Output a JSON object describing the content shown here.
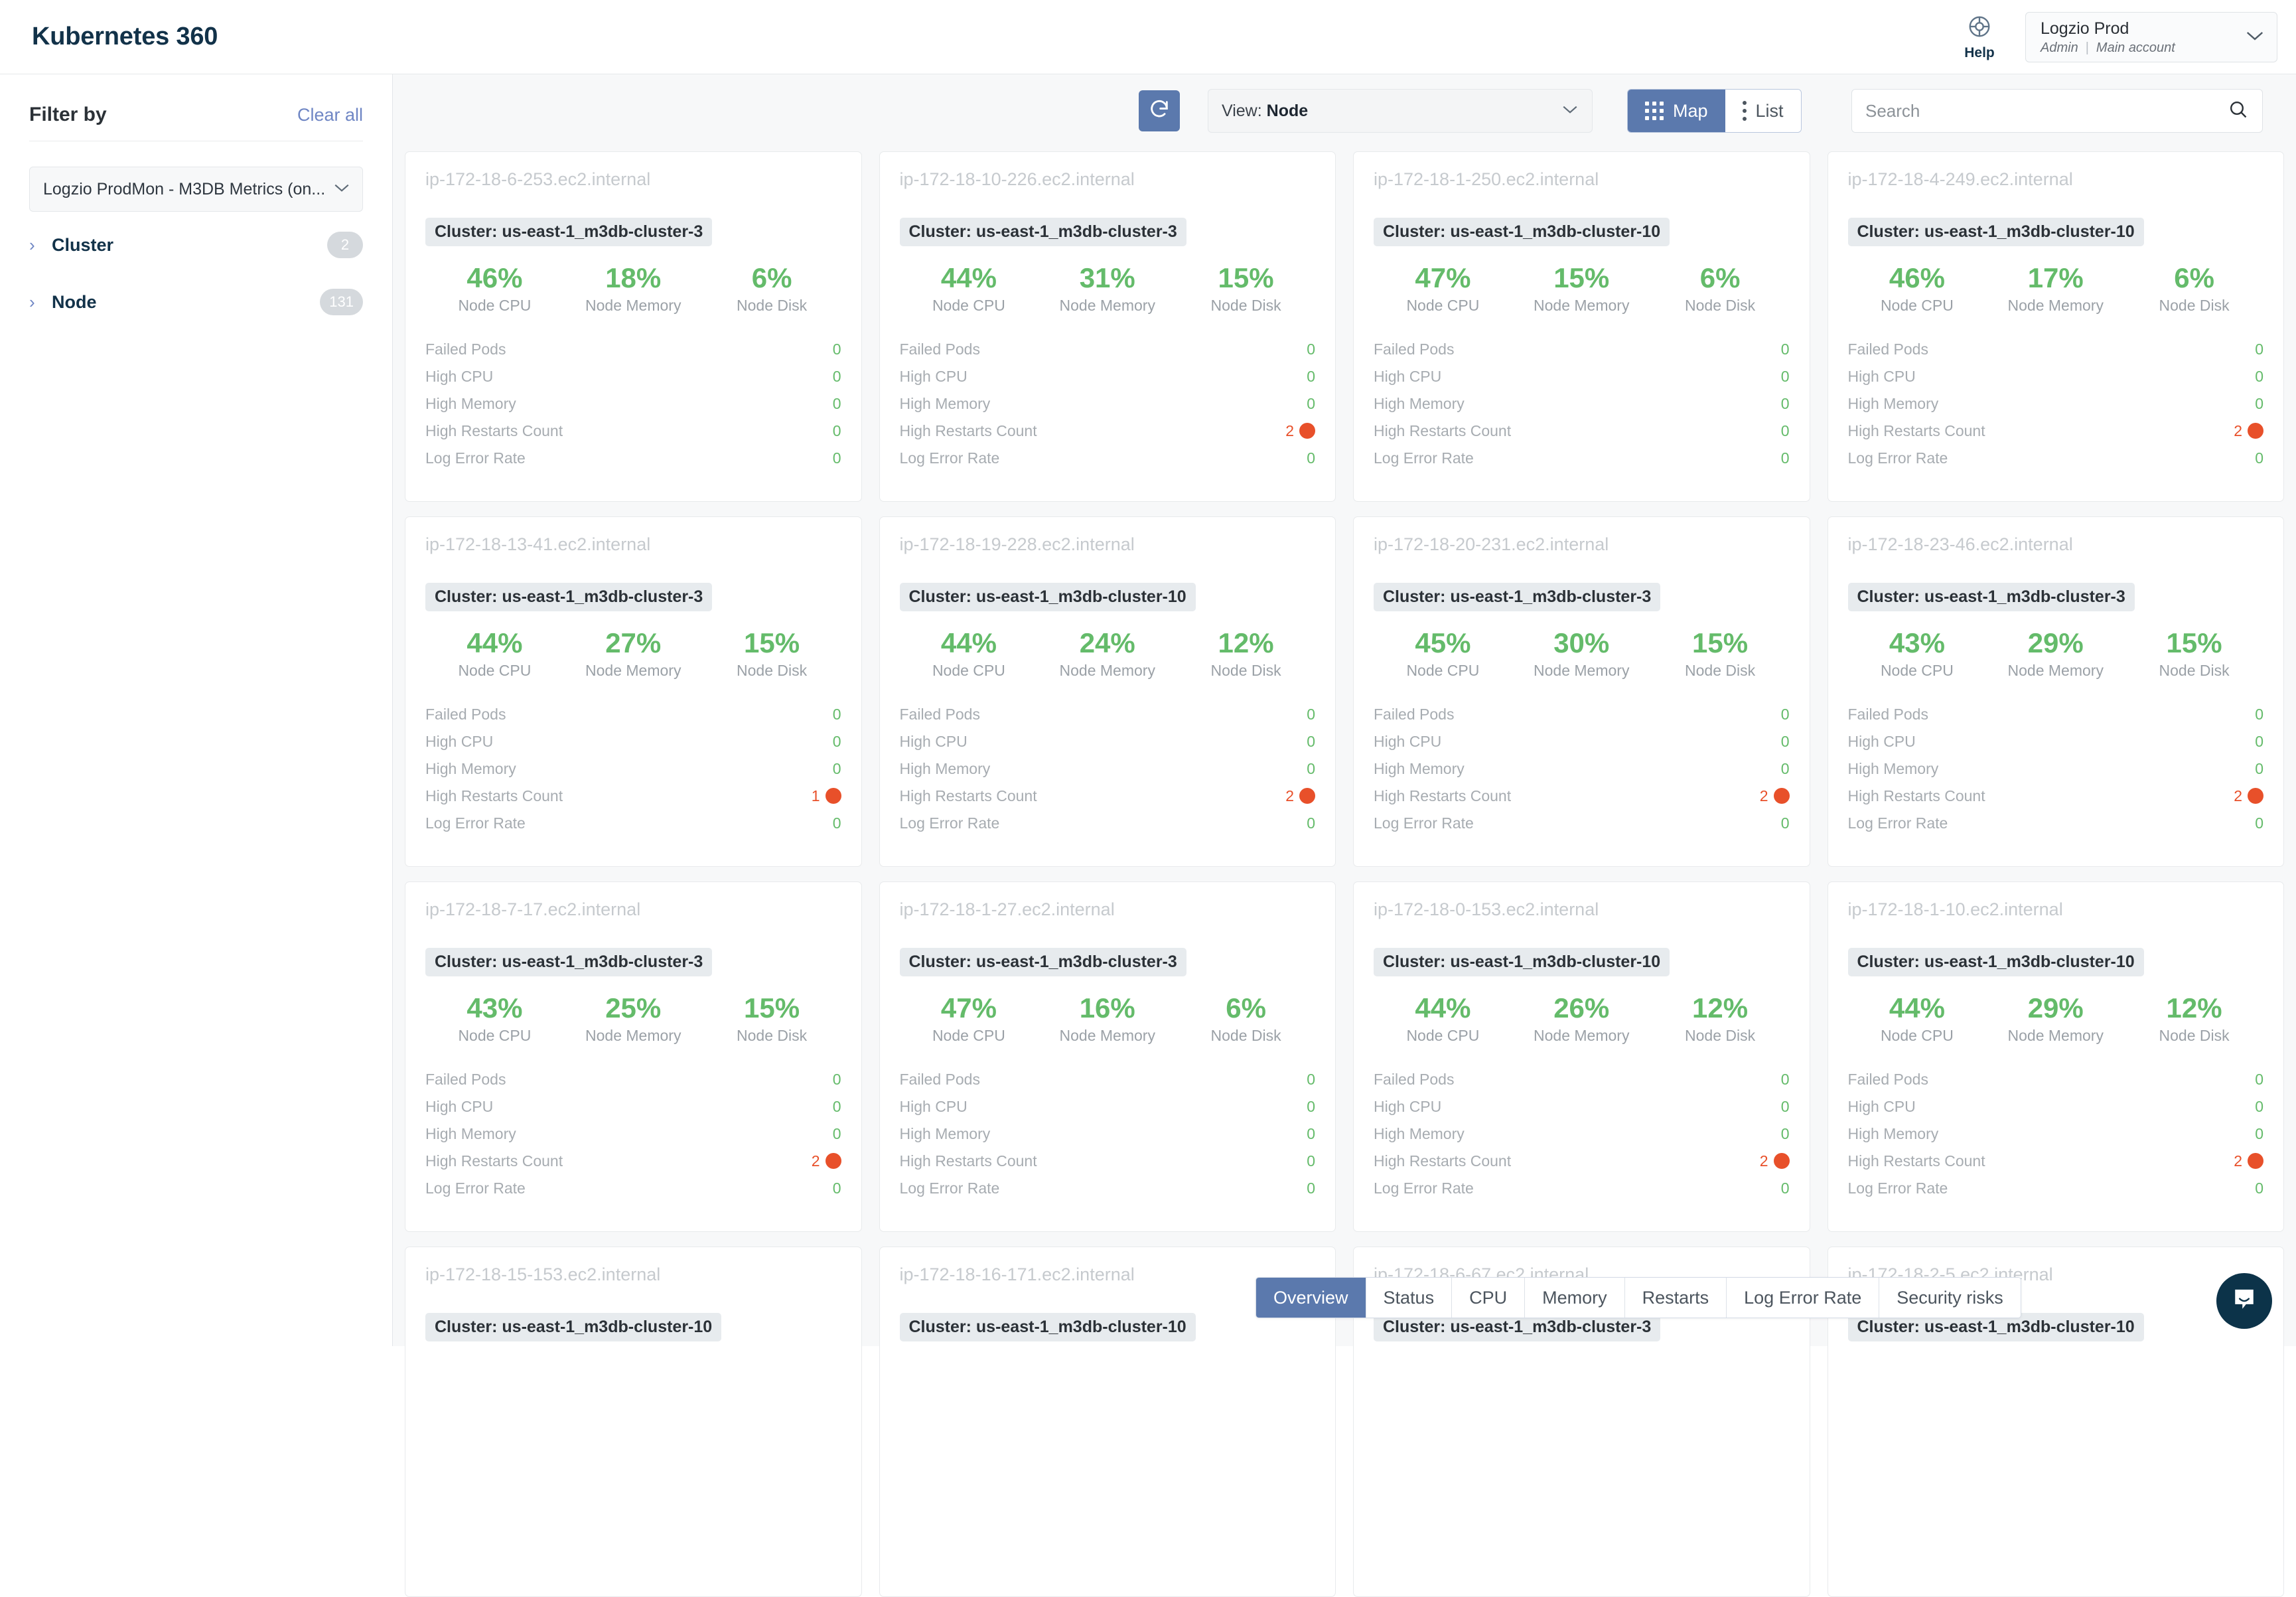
{
  "header": {
    "app_title": "Kubernetes 360",
    "help_label": "Help",
    "account_name": "Logzio Prod",
    "account_role": "Admin",
    "account_scope": "Main account"
  },
  "sidebar": {
    "filter_title": "Filter by",
    "clear_all": "Clear all",
    "datasource": "Logzio ProdMon - M3DB Metrics (on...",
    "facets": [
      {
        "name": "Cluster",
        "count": "2"
      },
      {
        "name": "Node",
        "count": "131"
      }
    ]
  },
  "toolbar": {
    "view_prefix": "View:",
    "view_value": "Node",
    "map_label": "Map",
    "list_label": "List",
    "active_mode": "Map",
    "search_placeholder": "Search",
    "search_value": ""
  },
  "metric_labels": {
    "cpu": "Node CPU",
    "memory": "Node Memory",
    "disk": "Node Disk"
  },
  "row_labels": [
    "Failed Pods",
    "High CPU",
    "High Memory",
    "High Restarts Count",
    "Log Error Rate"
  ],
  "colors": {
    "accent": "#5b79ad",
    "ok": "#64bb6a",
    "alert": "#e8502a",
    "title_muted": "#c6cace",
    "brand_dark": "#123249"
  },
  "tabs": [
    {
      "label": "Overview",
      "active": true
    },
    {
      "label": "Status",
      "active": false
    },
    {
      "label": "CPU",
      "active": false
    },
    {
      "label": "Memory",
      "active": false
    },
    {
      "label": "Restarts",
      "active": false
    },
    {
      "label": "Log Error Rate",
      "active": false
    },
    {
      "label": "Security risks",
      "active": false
    }
  ],
  "cards": [
    {
      "name": "ip-172-18-6-253.ec2.internal",
      "cluster": "Cluster: us-east-1_m3db-cluster-3",
      "cpu": "46%",
      "memory": "18%",
      "disk": "6%",
      "values": [
        "0",
        "0",
        "0",
        "0",
        "0"
      ],
      "alert_index": -1,
      "partial": false
    },
    {
      "name": "ip-172-18-10-226.ec2.internal",
      "cluster": "Cluster: us-east-1_m3db-cluster-3",
      "cpu": "44%",
      "memory": "31%",
      "disk": "15%",
      "values": [
        "0",
        "0",
        "0",
        "2",
        "0"
      ],
      "alert_index": 3,
      "partial": false
    },
    {
      "name": "ip-172-18-1-250.ec2.internal",
      "cluster": "Cluster: us-east-1_m3db-cluster-10",
      "cpu": "47%",
      "memory": "15%",
      "disk": "6%",
      "values": [
        "0",
        "0",
        "0",
        "0",
        "0"
      ],
      "alert_index": -1,
      "partial": false
    },
    {
      "name": "ip-172-18-4-249.ec2.internal",
      "cluster": "Cluster: us-east-1_m3db-cluster-10",
      "cpu": "46%",
      "memory": "17%",
      "disk": "6%",
      "values": [
        "0",
        "0",
        "0",
        "2",
        "0"
      ],
      "alert_index": 3,
      "partial": false
    },
    {
      "name": "ip-172-18-13-41.ec2.internal",
      "cluster": "Cluster: us-east-1_m3db-cluster-3",
      "cpu": "44%",
      "memory": "27%",
      "disk": "15%",
      "values": [
        "0",
        "0",
        "0",
        "1",
        "0"
      ],
      "alert_index": 3,
      "partial": false
    },
    {
      "name": "ip-172-18-19-228.ec2.internal",
      "cluster": "Cluster: us-east-1_m3db-cluster-10",
      "cpu": "44%",
      "memory": "24%",
      "disk": "12%",
      "values": [
        "0",
        "0",
        "0",
        "2",
        "0"
      ],
      "alert_index": 3,
      "partial": false
    },
    {
      "name": "ip-172-18-20-231.ec2.internal",
      "cluster": "Cluster: us-east-1_m3db-cluster-3",
      "cpu": "45%",
      "memory": "30%",
      "disk": "15%",
      "values": [
        "0",
        "0",
        "0",
        "2",
        "0"
      ],
      "alert_index": 3,
      "partial": false
    },
    {
      "name": "ip-172-18-23-46.ec2.internal",
      "cluster": "Cluster: us-east-1_m3db-cluster-3",
      "cpu": "43%",
      "memory": "29%",
      "disk": "15%",
      "values": [
        "0",
        "0",
        "0",
        "2",
        "0"
      ],
      "alert_index": 3,
      "partial": false
    },
    {
      "name": "ip-172-18-7-17.ec2.internal",
      "cluster": "Cluster: us-east-1_m3db-cluster-3",
      "cpu": "43%",
      "memory": "25%",
      "disk": "15%",
      "values": [
        "0",
        "0",
        "0",
        "2",
        "0"
      ],
      "alert_index": 3,
      "partial": false
    },
    {
      "name": "ip-172-18-1-27.ec2.internal",
      "cluster": "Cluster: us-east-1_m3db-cluster-3",
      "cpu": "47%",
      "memory": "16%",
      "disk": "6%",
      "values": [
        "0",
        "0",
        "0",
        "0",
        "0"
      ],
      "alert_index": -1,
      "partial": false
    },
    {
      "name": "ip-172-18-0-153.ec2.internal",
      "cluster": "Cluster: us-east-1_m3db-cluster-10",
      "cpu": "44%",
      "memory": "26%",
      "disk": "12%",
      "values": [
        "0",
        "0",
        "0",
        "2",
        "0"
      ],
      "alert_index": 3,
      "partial": false
    },
    {
      "name": "ip-172-18-1-10.ec2.internal",
      "cluster": "Cluster: us-east-1_m3db-cluster-10",
      "cpu": "44%",
      "memory": "29%",
      "disk": "12%",
      "values": [
        "0",
        "0",
        "0",
        "2",
        "0"
      ],
      "alert_index": 3,
      "partial": false
    },
    {
      "name": "ip-172-18-15-153.ec2.internal",
      "cluster": "Cluster: us-east-1_m3db-cluster-10",
      "cpu": "",
      "memory": "",
      "disk": "",
      "values": [
        "",
        "",
        "",
        "",
        ""
      ],
      "alert_index": -1,
      "partial": true
    },
    {
      "name": "ip-172-18-16-171.ec2.internal",
      "cluster": "Cluster: us-east-1_m3db-cluster-10",
      "cpu": "",
      "memory": "",
      "disk": "",
      "values": [
        "",
        "",
        "",
        "",
        ""
      ],
      "alert_index": -1,
      "partial": true
    },
    {
      "name": "ip-172-18-6-67.ec2.internal",
      "cluster": "Cluster: us-east-1_m3db-cluster-3",
      "cpu": "",
      "memory": "",
      "disk": "",
      "values": [
        "",
        "",
        "",
        "",
        ""
      ],
      "alert_index": -1,
      "partial": true
    },
    {
      "name": "ip-172-18-2-5.ec2.internal",
      "cluster": "Cluster: us-east-1_m3db-cluster-10",
      "cpu": "",
      "memory": "",
      "disk": "",
      "values": [
        "",
        "",
        "",
        "",
        ""
      ],
      "alert_index": -1,
      "partial": true
    }
  ]
}
